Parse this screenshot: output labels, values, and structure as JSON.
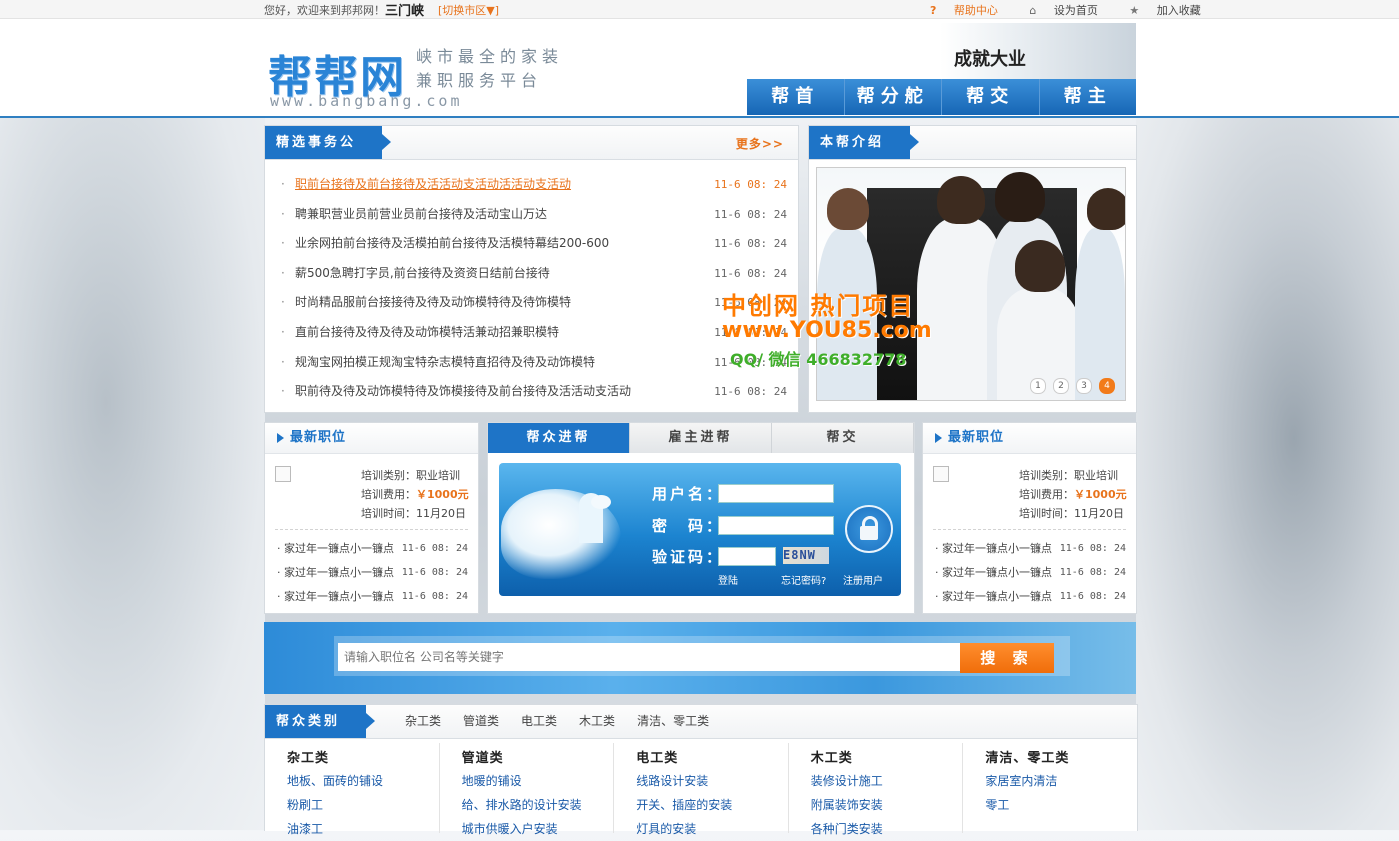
{
  "topbar": {
    "welcome": "您好，欢迎来到邦邦网！",
    "city": "三门峡",
    "switch_city": "[切换市区▼]",
    "help": "帮助中心",
    "set_home": "设为首页",
    "favorite": "加入收藏"
  },
  "header": {
    "logo": "帮帮网",
    "slogan_line1": "峡市最全的家装",
    "slogan_line2": "兼职服务平台",
    "domain": "www.bangbang.com",
    "calligraphy": "成就大业",
    "nav": [
      "帮首",
      "帮分舵",
      "帮交",
      "帮主"
    ]
  },
  "featured": {
    "title": "精选事务公",
    "more": "更多>>",
    "items": [
      {
        "title": "职前台接待及前台接待及活活动支活动活活动支活动",
        "date": "11-6 08: 24"
      },
      {
        "title": "聘兼职营业员前营业员前台接待及活动宝山万达",
        "date": "11-6 08: 24"
      },
      {
        "title": "业余网拍前台接待及活模拍前台接待及活模特幕结200-600",
        "date": "11-6 08: 24"
      },
      {
        "title": "薪500急聘打字员,前台接待及资资日结前台接待",
        "date": "11-6 08: 24"
      },
      {
        "title": "时尚精品服前台接接待及待及动饰模特待及待饰模特",
        "date": "11-6 08: 24"
      },
      {
        "title": "直前台接待及待及待及动饰模特活兼动招兼职模特",
        "date": "11-6 08: 24"
      },
      {
        "title": "规淘宝网拍模正规淘宝特杂志模特直招待及待及动饰模特",
        "date": "11-6 08: 24"
      },
      {
        "title": "职前待及待及动饰模特待及饰模接待及前台接待及活活动支活动",
        "date": "11-6 08: 24"
      }
    ]
  },
  "intro": {
    "title": "本帮介绍",
    "pages": [
      "1",
      "2",
      "3",
      "4"
    ]
  },
  "watermark": {
    "line1": "中创网 热门项目",
    "line2": "www.YOU85.com",
    "line3": "QQ/ 微信 466832778"
  },
  "jobs_left": {
    "title": "最新职位",
    "type": "培训类别：职业培训",
    "fee_label": "培训费用：",
    "fee": "￥1000元",
    "time": "培训时间：11月20日",
    "list": [
      {
        "title": "· 家过年一镰点小一镰点",
        "date": "11-6 08: 24"
      },
      {
        "title": "· 家过年一镰点小一镰点",
        "date": "11-6 08: 24"
      },
      {
        "title": "· 家过年一镰点小一镰点",
        "date": "11-6 08: 24"
      }
    ]
  },
  "jobs_right": {
    "title": "最新职位",
    "type": "培训类别：职业培训",
    "fee_label": "培训费用：",
    "fee": "￥1000元",
    "time": "培训时间：11月20日",
    "list": [
      {
        "title": "· 家过年一镰点小一镰点",
        "date": "11-6 08: 24"
      },
      {
        "title": "· 家过年一镰点小一镰点",
        "date": "11-6 08: 24"
      },
      {
        "title": "· 家过年一镰点小一镰点",
        "date": "11-6 08: 24"
      }
    ]
  },
  "login": {
    "tabs": [
      "帮众进帮",
      "雇主进帮",
      "帮交"
    ],
    "username_label": "用户名：",
    "password_label": "密　码：",
    "captcha_label": "验证码：",
    "captcha_text": "E8NW",
    "login_link": "登陆",
    "forgot_link": "忘记密码?",
    "register_link": "注册用户"
  },
  "search": {
    "placeholder": "请输入职位名 公司名等关键字",
    "button": "搜 索"
  },
  "categories": {
    "title": "帮众类别",
    "tabs": [
      "杂工类",
      "管道类",
      "电工类",
      "木工类",
      "清洁、零工类"
    ],
    "columns": [
      {
        "heading": "杂工类",
        "links": [
          "地板、面砖的铺设",
          "粉刷工",
          "油漆工"
        ]
      },
      {
        "heading": "管道类",
        "links": [
          "地暖的铺设",
          "给、排水路的设计安装",
          "城市供暖入户安装"
        ]
      },
      {
        "heading": "电工类",
        "links": [
          "线路设计安装",
          "开关、插座的安装",
          "灯具的安装"
        ]
      },
      {
        "heading": "木工类",
        "links": [
          "装修设计施工",
          "附属装饰安装",
          "各种门类安装"
        ]
      },
      {
        "heading": "清洁、零工类",
        "links": [
          "家居室内清洁",
          "零工"
        ]
      }
    ]
  },
  "colors": {
    "brand_blue": "#1e74c7",
    "accent_orange": "#e8731c"
  }
}
